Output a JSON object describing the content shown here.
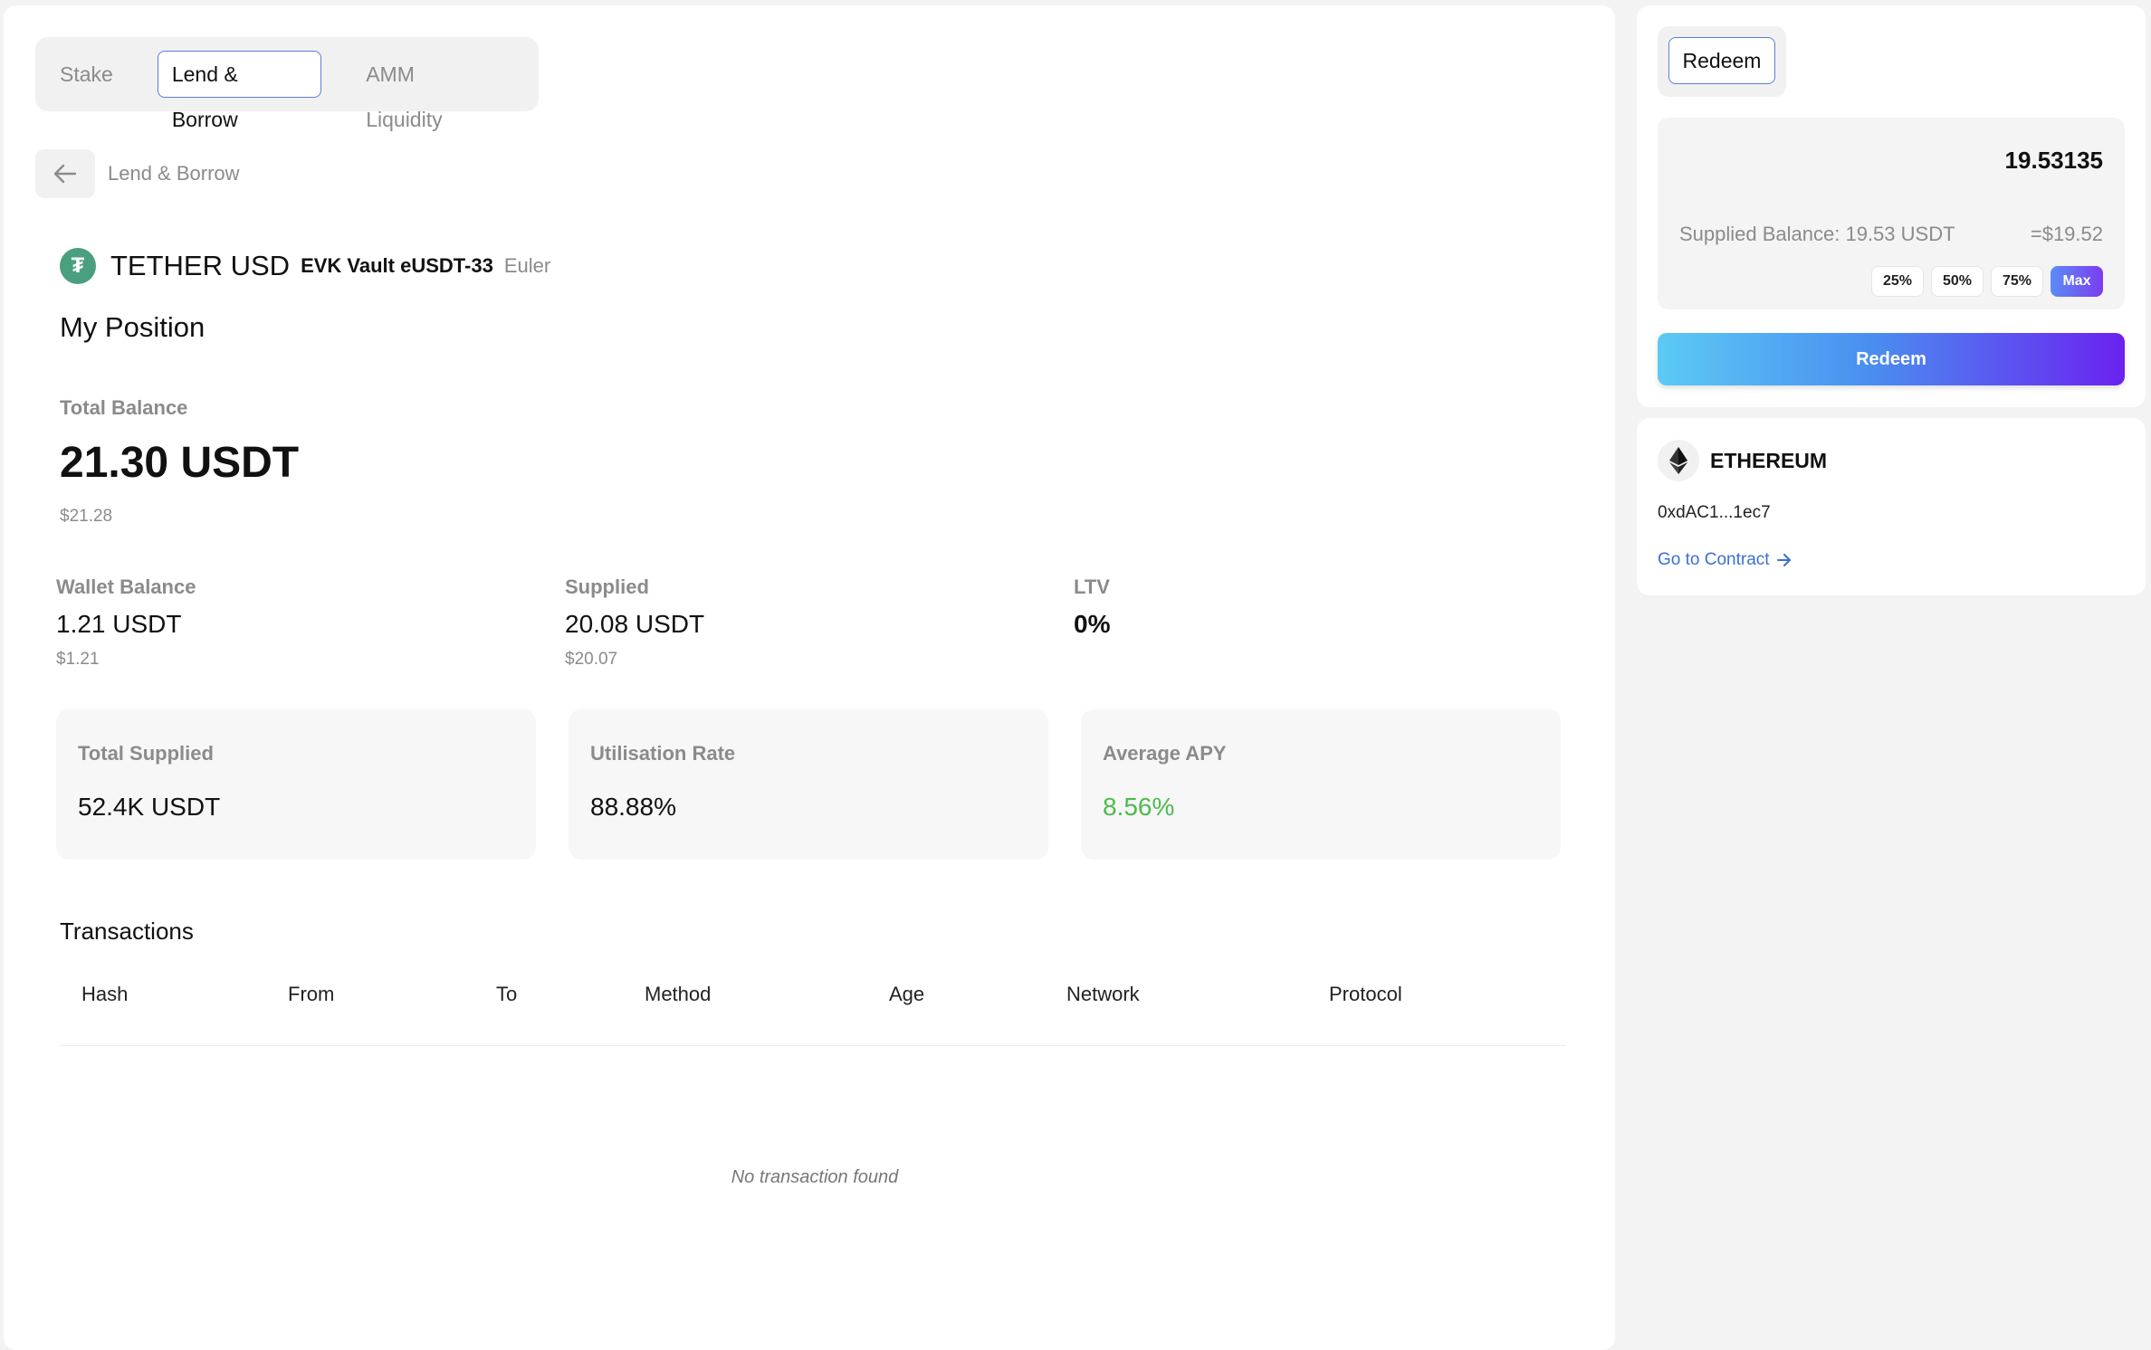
{
  "tabs": [
    {
      "label": "Stake",
      "active": false
    },
    {
      "label": "Lend & Borrow",
      "active": true
    },
    {
      "label": "AMM Liquidity",
      "active": false
    }
  ],
  "breadcrumb": {
    "label": "Lend & Borrow",
    "icon": "arrow-left-icon"
  },
  "asset": {
    "icon": "tether-icon",
    "name": "TETHER USD",
    "vault": "EVK Vault eUSDT-33",
    "protocol": "Euler",
    "icon_color": "#4a9f7e"
  },
  "position": {
    "title": "My Position",
    "total_label": "Total Balance",
    "total_value": "21.30 USDT",
    "total_usd": "$21.28",
    "stats": [
      {
        "label": "Wallet Balance",
        "value": "1.21 USDT",
        "sub": "$1.21"
      },
      {
        "label": "Supplied",
        "value": "20.08 USDT",
        "sub": "$20.07"
      },
      {
        "label": "LTV",
        "value": "0%",
        "sub": ""
      }
    ],
    "cards": [
      {
        "label": "Total Supplied",
        "value": "52.4K USDT"
      },
      {
        "label": "Utilisation Rate",
        "value": "88.88%"
      },
      {
        "label": "Average APY",
        "value": "8.56%",
        "color": "#4cbb4f"
      }
    ]
  },
  "transactions": {
    "title": "Transactions",
    "columns": [
      "Hash",
      "From",
      "To",
      "Method",
      "Age",
      "Network",
      "Protocol"
    ],
    "rows": [],
    "empty_text": "No transaction found"
  },
  "redeem_panel": {
    "tab_label": "Redeem",
    "amount": "19.53135",
    "supplied_balance": "Supplied Balance: 19.53 USDT",
    "usd_equiv": "=$19.52",
    "percent_options": [
      "25%",
      "50%",
      "75%",
      "Max"
    ],
    "button_label": "Redeem",
    "accent_gradient": [
      "#5ccaf4",
      "#4a8ff0",
      "#6a22f0"
    ]
  },
  "network_panel": {
    "icon": "ethereum-icon",
    "name": "ETHEREUM",
    "address": "0xdAC1...1ec7",
    "link_label": "Go to Contract",
    "link_color": "#3a6fd8"
  }
}
